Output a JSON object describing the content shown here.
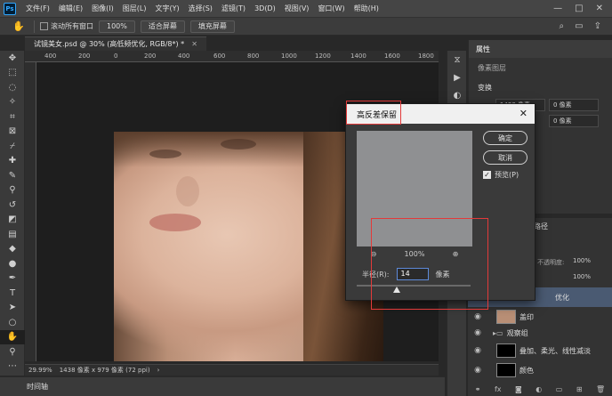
{
  "menu": {
    "logo": "Ps",
    "items": [
      "文件(F)",
      "编辑(E)",
      "图像(I)",
      "图层(L)",
      "文字(Y)",
      "选择(S)",
      "滤镜(T)",
      "3D(D)",
      "视图(V)",
      "窗口(W)",
      "帮助(H)"
    ],
    "window_controls": [
      "—",
      "□",
      "✕"
    ]
  },
  "options": {
    "scroll_all_label": "滚动所有窗口",
    "zoom_value": "100%",
    "fit_screen": "适合屏幕",
    "fill_screen": "填充屏幕"
  },
  "document": {
    "tab_title": "试镜美女.psd @ 30% (高低频优化, RGB/8*) *",
    "ruler_ticks": [
      "400",
      "200",
      "0",
      "200",
      "400",
      "600",
      "800",
      "1000",
      "1200",
      "1400",
      "1600",
      "1800"
    ]
  },
  "status": {
    "zoom": "29.99%",
    "dimensions": "1438 像素 x 979 像素 (72 ppi)",
    "arrow": "›"
  },
  "timeline": {
    "label": "时间轴"
  },
  "dialog": {
    "title": "高反差保留",
    "ok": "确定",
    "cancel": "取消",
    "preview_label": "预览(P)",
    "preview_checked": true,
    "zoom_percent": "100%",
    "radius_label": "半径(R):",
    "radius_value": "14",
    "radius_unit": "像素",
    "slider_level": 0.35
  },
  "properties": {
    "header": "属性",
    "pixel_layer_label": "像素图层",
    "transform_label": "变换",
    "w_value": "1438 像素",
    "x_value": "0 像素",
    "y_value": "0 像素"
  },
  "layers": {
    "tab_label": "路径",
    "opacity_label": "不透明度:",
    "opacity_value": "100%",
    "fill_value": "100%",
    "rows": [
      {
        "name": "优化",
        "selected": true
      },
      {
        "name": "盖印",
        "selected": false
      },
      {
        "name": "观察组",
        "selected": false
      },
      {
        "name": "叠加、柔光、线性减淡",
        "selected": false
      },
      {
        "name": "颜色",
        "selected": false
      }
    ]
  },
  "colors": {
    "annotation_red": "#e23a3a",
    "accent_blue": "#5d8ad9"
  }
}
